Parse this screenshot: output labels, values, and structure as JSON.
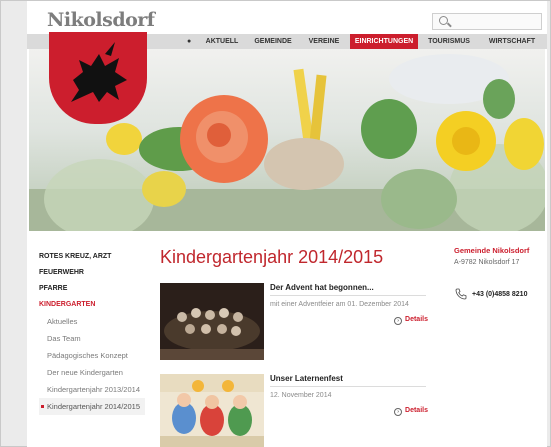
{
  "header": {
    "logo": "Nikolsdorf",
    "search_placeholder": ""
  },
  "nav": {
    "items": [
      {
        "label": "AKTUELL"
      },
      {
        "label": "GEMEINDE"
      },
      {
        "label": "VEREINE"
      },
      {
        "label": "EINRICHTUNGEN",
        "active": true
      },
      {
        "label": "TOURISMUS"
      },
      {
        "label": "WIRTSCHAFT"
      }
    ]
  },
  "sidebar": {
    "items": [
      {
        "label": "ROTES KREUZ, ARZT"
      },
      {
        "label": "FEUERWEHR"
      },
      {
        "label": "PFARRE"
      },
      {
        "label": "KINDERGARTEN",
        "active": true
      }
    ],
    "subitems": [
      {
        "label": "Aktuelles"
      },
      {
        "label": "Das Team"
      },
      {
        "label": "Pädagogisches Konzept"
      },
      {
        "label": "Der neue Kindergarten"
      },
      {
        "label": "Kindergartenjahr 2013/2014"
      },
      {
        "label": "Kindergartenjahr 2014/2015",
        "current": true
      }
    ]
  },
  "main": {
    "title": "Kindergartenjahr 2014/2015",
    "articles": [
      {
        "title": "Der Advent hat begonnen...",
        "subtitle": "mit einer Adventfeier am 01. Dezember 2014",
        "details": "Details"
      },
      {
        "title": "Unser Laternenfest",
        "subtitle": "12. November 2014",
        "details": "Details"
      }
    ]
  },
  "contact": {
    "name": "Gemeinde Nikolsdorf",
    "address": "A-9782 Nikolsdorf 17",
    "phone": "+43 (0)4858 8210"
  },
  "colors": {
    "brand_red": "#cc1e2d",
    "nav_bg": "#dadada"
  },
  "icons": [
    "search-icon",
    "coat-of-arms-icon",
    "details-arrow-icon",
    "phone-icon"
  ]
}
